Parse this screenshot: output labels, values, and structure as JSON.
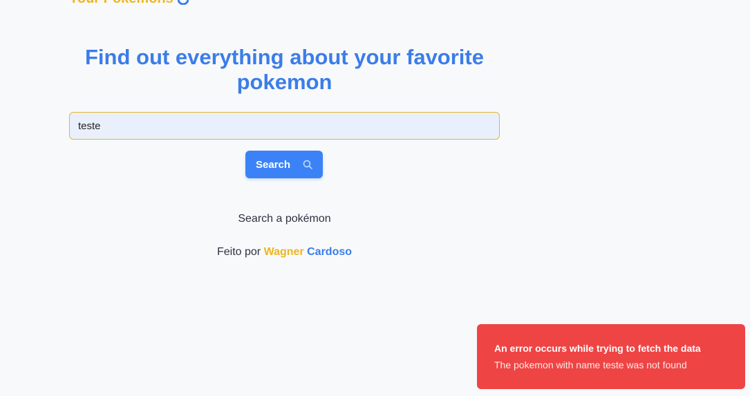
{
  "header": {
    "logo_text": "Your Pokemons",
    "colors": {
      "brand_yellow": "#ecb622",
      "brand_blue": "#3b7de9"
    }
  },
  "main": {
    "title": "Find out everything about your favorite pokemon",
    "search": {
      "value": "teste",
      "placeholder": ""
    },
    "search_button_label": "Search",
    "hint": "Search a pokémon"
  },
  "footer": {
    "prefix": "Feito por ",
    "author_first": "Wagner",
    "author_last": "Cardoso"
  },
  "toast": {
    "title": "An error occurs while trying to fetch the data",
    "message": "The pokemon with name teste was not found",
    "color": "#ef4444"
  }
}
